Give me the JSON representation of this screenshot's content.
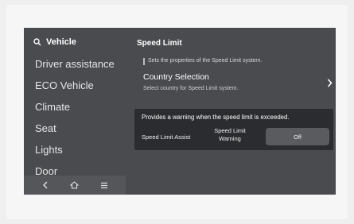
{
  "sidebar": {
    "search_label": "Vehicle",
    "items": [
      {
        "label": "Driver assistance"
      },
      {
        "label": "ECO Vehicle"
      },
      {
        "label": "Climate"
      },
      {
        "label": "Seat"
      },
      {
        "label": "Lights"
      },
      {
        "label": "Door"
      }
    ],
    "nav": [
      {
        "icon": "back-icon"
      },
      {
        "icon": "home-icon"
      },
      {
        "icon": "menu-icon"
      }
    ]
  },
  "content": {
    "title": "Speed Limit",
    "description": "Sets the properties of the Speed Limit system.",
    "country": {
      "title": "Country Selection",
      "subtitle": "Select country for Speed Limit system."
    }
  },
  "popup": {
    "message": "Provides a warning when the speed limit is exceeded.",
    "left_label": "Speed Limit Assist",
    "middle_label": "Speed Limit Warning",
    "button_label": "Off"
  },
  "colors": {
    "screen_bg": "#4a4b4f",
    "popup_bg": "#2b2c2f",
    "button_bg": "#5a5b5f",
    "text": "#ffffff"
  }
}
